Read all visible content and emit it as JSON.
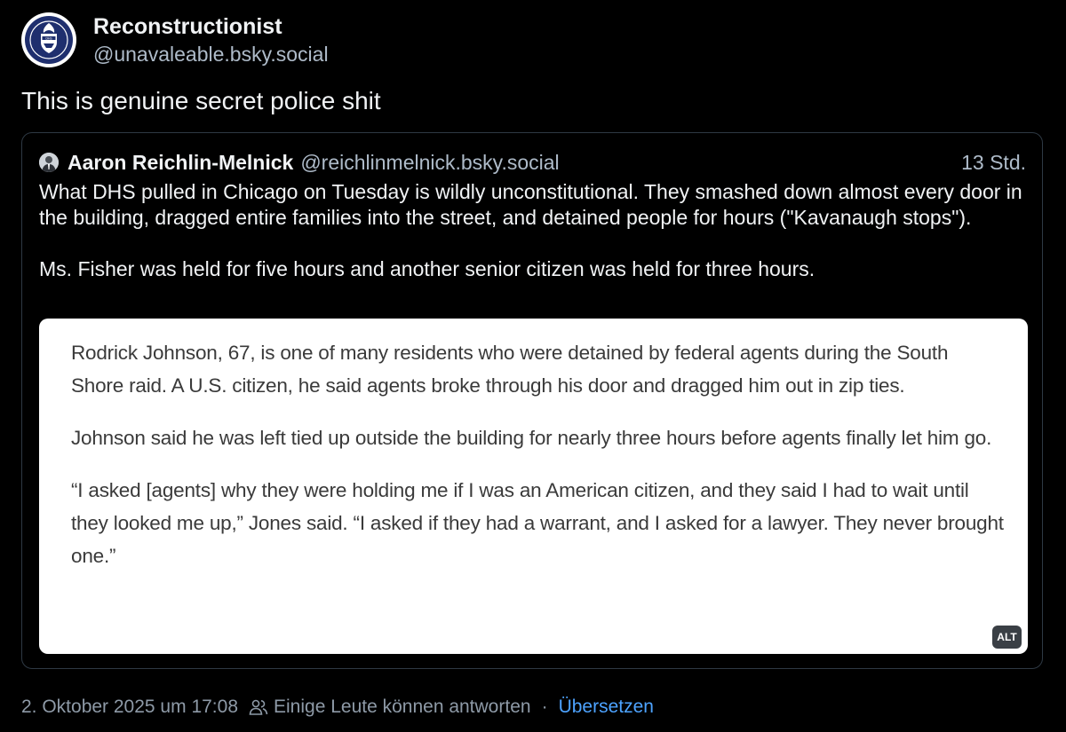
{
  "post": {
    "author": {
      "display_name": "Reconstructionist",
      "handle": "@unavaleable.bsky.social",
      "avatar_icon": "dhs-seal-avatar"
    },
    "text": "This is genuine secret police shit"
  },
  "quote": {
    "author": {
      "display_name": "Aaron Reichlin-Melnick",
      "handle": "@reichlinmelnick.bsky.social",
      "avatar_icon": "person-avatar"
    },
    "timestamp": "13 Std.",
    "paragraphs": [
      "What DHS pulled in Chicago on Tuesday is wildly unconstitutional. They smashed down almost every door in the building, dragged entire families into the street, and detained people for hours (\"Kavanaugh stops\").",
      "Ms. Fisher was held for five hours and another senior citizen was held for three hours."
    ],
    "image": {
      "paragraphs": [
        "Rodrick Johnson, 67, is one of many residents who were detained by federal agents during the South Shore raid. A U.S. citizen, he said agents broke through his door and dragged him out in zip ties.",
        "Johnson said he was left tied up outside the building for nearly three hours before agents finally let him go.",
        "“I asked [agents] why they were holding me if I was an American citizen, and they said I had to wait until they looked me up,” Jones said. “I asked if they had a warrant, and I asked for a lawyer. They never brought one.”"
      ],
      "alt_badge": "ALT"
    }
  },
  "footer": {
    "date": "2. Oktober 2025 um 17:08",
    "reply_setting": "Einige Leute können antworten",
    "separator": "·",
    "translate_label": "Übersetzen",
    "reply_icon": "people-icon"
  },
  "colors": {
    "background": "#000000",
    "text": "#f1f3f5",
    "muted": "#aebbc9",
    "link": "#4da3ff",
    "border": "#2e3944"
  }
}
